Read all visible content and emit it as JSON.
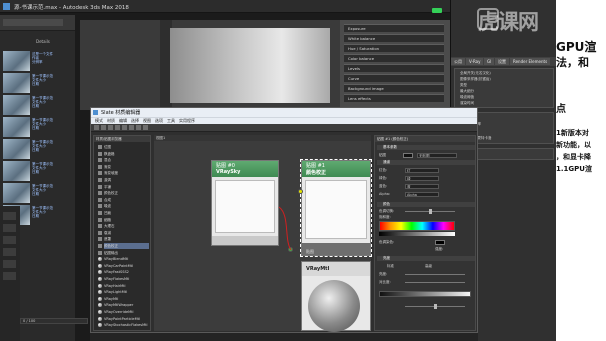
{
  "app": {
    "title": "源-书课示范.max - Autodesk 3ds Max 2018"
  },
  "file_browser": {
    "header": "Details",
    "thumbnails": [
      {
        "lines": [
          "这是一个文件",
          "作者",
          "分辨率"
        ]
      },
      {
        "lines": [
          "第一节课示范",
          "文件大小",
          "日期"
        ]
      },
      {
        "lines": [
          "第一节课示范",
          "文件大小",
          "日期"
        ]
      },
      {
        "lines": [
          "第一节课示范",
          "文件大小",
          "日期"
        ]
      },
      {
        "lines": [
          "第一节课示范",
          "文件大小",
          "日期"
        ]
      },
      {
        "lines": [
          "第一节课示范",
          "文件大小",
          "日期"
        ]
      },
      {
        "lines": [
          "第一节课示范",
          "文件大小",
          "日期"
        ]
      },
      {
        "lines": [
          "第一节课示范",
          "文件大小",
          "日期"
        ]
      }
    ]
  },
  "render_setup": {
    "rows": [
      "Exposure",
      "White balance",
      "Hue / Saturation",
      "Color balance",
      "Levels",
      "Curve",
      "Background image",
      "Lens effects"
    ]
  },
  "command_panel": {
    "tabs": [
      "公用",
      "V-Ray",
      "GI",
      "设置",
      "Render Elements"
    ],
    "lines": [
      "全局开关(无名汉化)",
      "图像采样器(抗锯齿)",
      "图像过滤器",
      "最小着色速率",
      "渲染遮罩",
      "全局确定性蒙特卡洛",
      "颜色贴图"
    ],
    "labels": [
      "类型",
      "块",
      "渐进",
      "最大细分",
      "噪波阈值",
      "渲染时间"
    ]
  },
  "tutorial_text": {
    "line1": "GPU渲",
    "line2": "法，和",
    "line3": "点",
    "line4": "1新版本对",
    "line5": "新功能，以",
    "line6": "，和显卡降",
    "line7": "1.1GPU渲"
  },
  "logo": {
    "text": "虎课网"
  },
  "slate": {
    "title": "Slate 材质编辑器",
    "menus": [
      "模式",
      "材质",
      "编辑",
      "选择",
      "视图",
      "选项",
      "工具",
      "实用程序"
    ],
    "browser_header": "材质/贴图浏览器",
    "browser_items": [
      {
        "label": "位图",
        "type": "map"
      },
      {
        "label": "棋盘格",
        "type": "map"
      },
      {
        "label": "混合",
        "type": "map"
      },
      {
        "label": "渐变",
        "type": "map"
      },
      {
        "label": "渐变坡度",
        "type": "map"
      },
      {
        "label": "漩涡",
        "type": "map"
      },
      {
        "label": "平铺",
        "type": "map"
      },
      {
        "label": "颜色校正",
        "type": "map",
        "selected": false
      },
      {
        "label": "合成",
        "type": "map"
      },
      {
        "label": "噪波",
        "type": "map"
      },
      {
        "label": "凹痕",
        "type": "map"
      },
      {
        "label": "细胞",
        "type": "map"
      },
      {
        "label": "大理石",
        "type": "map"
      },
      {
        "label": "衰减",
        "type": "map"
      },
      {
        "label": "遮罩",
        "type": "map"
      },
      {
        "label": "颜色校正",
        "type": "map",
        "selected": true
      },
      {
        "label": "贴图输出",
        "type": "map"
      },
      {
        "label": "VRayBlendMtl",
        "type": "mat"
      },
      {
        "label": "VRayCarPaintMtl",
        "type": "mat"
      },
      {
        "label": "VRayFastSSS2",
        "type": "mat"
      },
      {
        "label": "VRayFlakesMtl",
        "type": "mat"
      },
      {
        "label": "VRayHairMtl",
        "type": "mat"
      },
      {
        "label": "VRayLightMtl",
        "type": "mat"
      },
      {
        "label": "VRayMtl",
        "type": "mat"
      },
      {
        "label": "VRayMtlWrapper",
        "type": "mat"
      },
      {
        "label": "VRayOverrideMtl",
        "type": "mat"
      },
      {
        "label": "VRayPointParticleMtl",
        "type": "mat"
      },
      {
        "label": "VRayStochasticFlakesMtl",
        "type": "mat"
      }
    ],
    "view_tab": "视图1",
    "nodes": {
      "sky": {
        "id": "贴图 #0",
        "type": "VRaySky"
      },
      "cc": {
        "id": "贴图 #1",
        "type": "颜色校正"
      },
      "mtl": {
        "label": "VRayMtl"
      }
    },
    "connector_label": "贴图",
    "param_header": "贴图 #1 (颜色校正)",
    "params": {
      "section_basic": "基本参数",
      "map_label": "贴图",
      "map_value": "无贴图",
      "channels_label": "通道",
      "channel_rows": [
        {
          "label": "红色:",
          "value": "红"
        },
        {
          "label": "绿色:",
          "value": "绿"
        },
        {
          "label": "蓝色:",
          "value": "蓝"
        },
        {
          "label": "Alpha:",
          "value": "Alpha"
        }
      ],
      "section_color": "颜色",
      "hue_label": "色调切换:",
      "saturation_label": "饱和度:",
      "hue_tint_label": "色调染色:",
      "strength_label": "强度:",
      "section_lightness": "亮度",
      "standard_label": "标准",
      "advanced_label": "高级",
      "brightness_label": "亮度:",
      "contrast_label": "对比度:"
    }
  },
  "timeline": {
    "label": "0 / 100"
  },
  "colors": {
    "node_header": "#4f9b62",
    "socket": "#e6e600",
    "wire": "#d02020",
    "accent_green": "#34d058"
  }
}
